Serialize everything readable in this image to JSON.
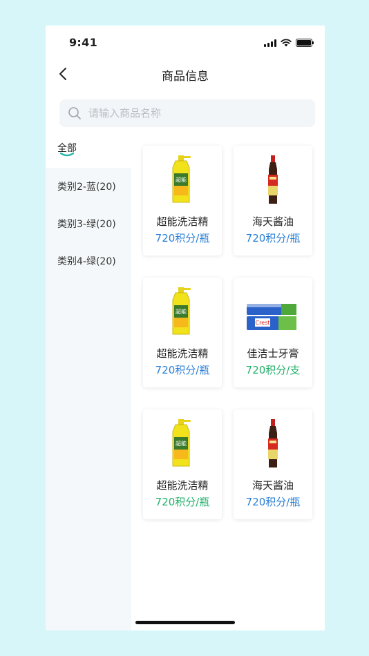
{
  "status": {
    "time": "9:41"
  },
  "nav": {
    "title": "商品信息"
  },
  "search": {
    "placeholder": "请输入商品名称",
    "value": ""
  },
  "colors": {
    "accent": "#22b6a8",
    "price_blue": "#2b7fd6",
    "price_green": "#22b06a"
  },
  "sidebar": {
    "items": [
      {
        "label": "全部",
        "active": true
      },
      {
        "label": "类别2-蓝(20)",
        "active": false
      },
      {
        "label": "类别3-绿(20)",
        "active": false
      },
      {
        "label": "类别4-绿(20)",
        "active": false
      }
    ]
  },
  "products": [
    {
      "name": "超能洗洁精",
      "price": "720积分/瓶",
      "price_color": "#2b7fd6",
      "icon": "dish-soap-bottle-icon"
    },
    {
      "name": "海天酱油",
      "price": "720积分/瓶",
      "price_color": "#2b7fd6",
      "icon": "soy-sauce-bottle-icon"
    },
    {
      "name": "超能洗洁精",
      "price": "720积分/瓶",
      "price_color": "#2b7fd6",
      "icon": "dish-soap-bottle-icon"
    },
    {
      "name": "佳洁士牙膏",
      "price": "720积分/支",
      "price_color": "#22b06a",
      "icon": "toothpaste-box-icon"
    },
    {
      "name": "超能洗洁精",
      "price": "720积分/瓶",
      "price_color": "#22b06a",
      "icon": "dish-soap-bottle-icon"
    },
    {
      "name": "海天酱油",
      "price": "720积分/瓶",
      "price_color": "#2b7fd6",
      "icon": "soy-sauce-bottle-icon"
    }
  ]
}
